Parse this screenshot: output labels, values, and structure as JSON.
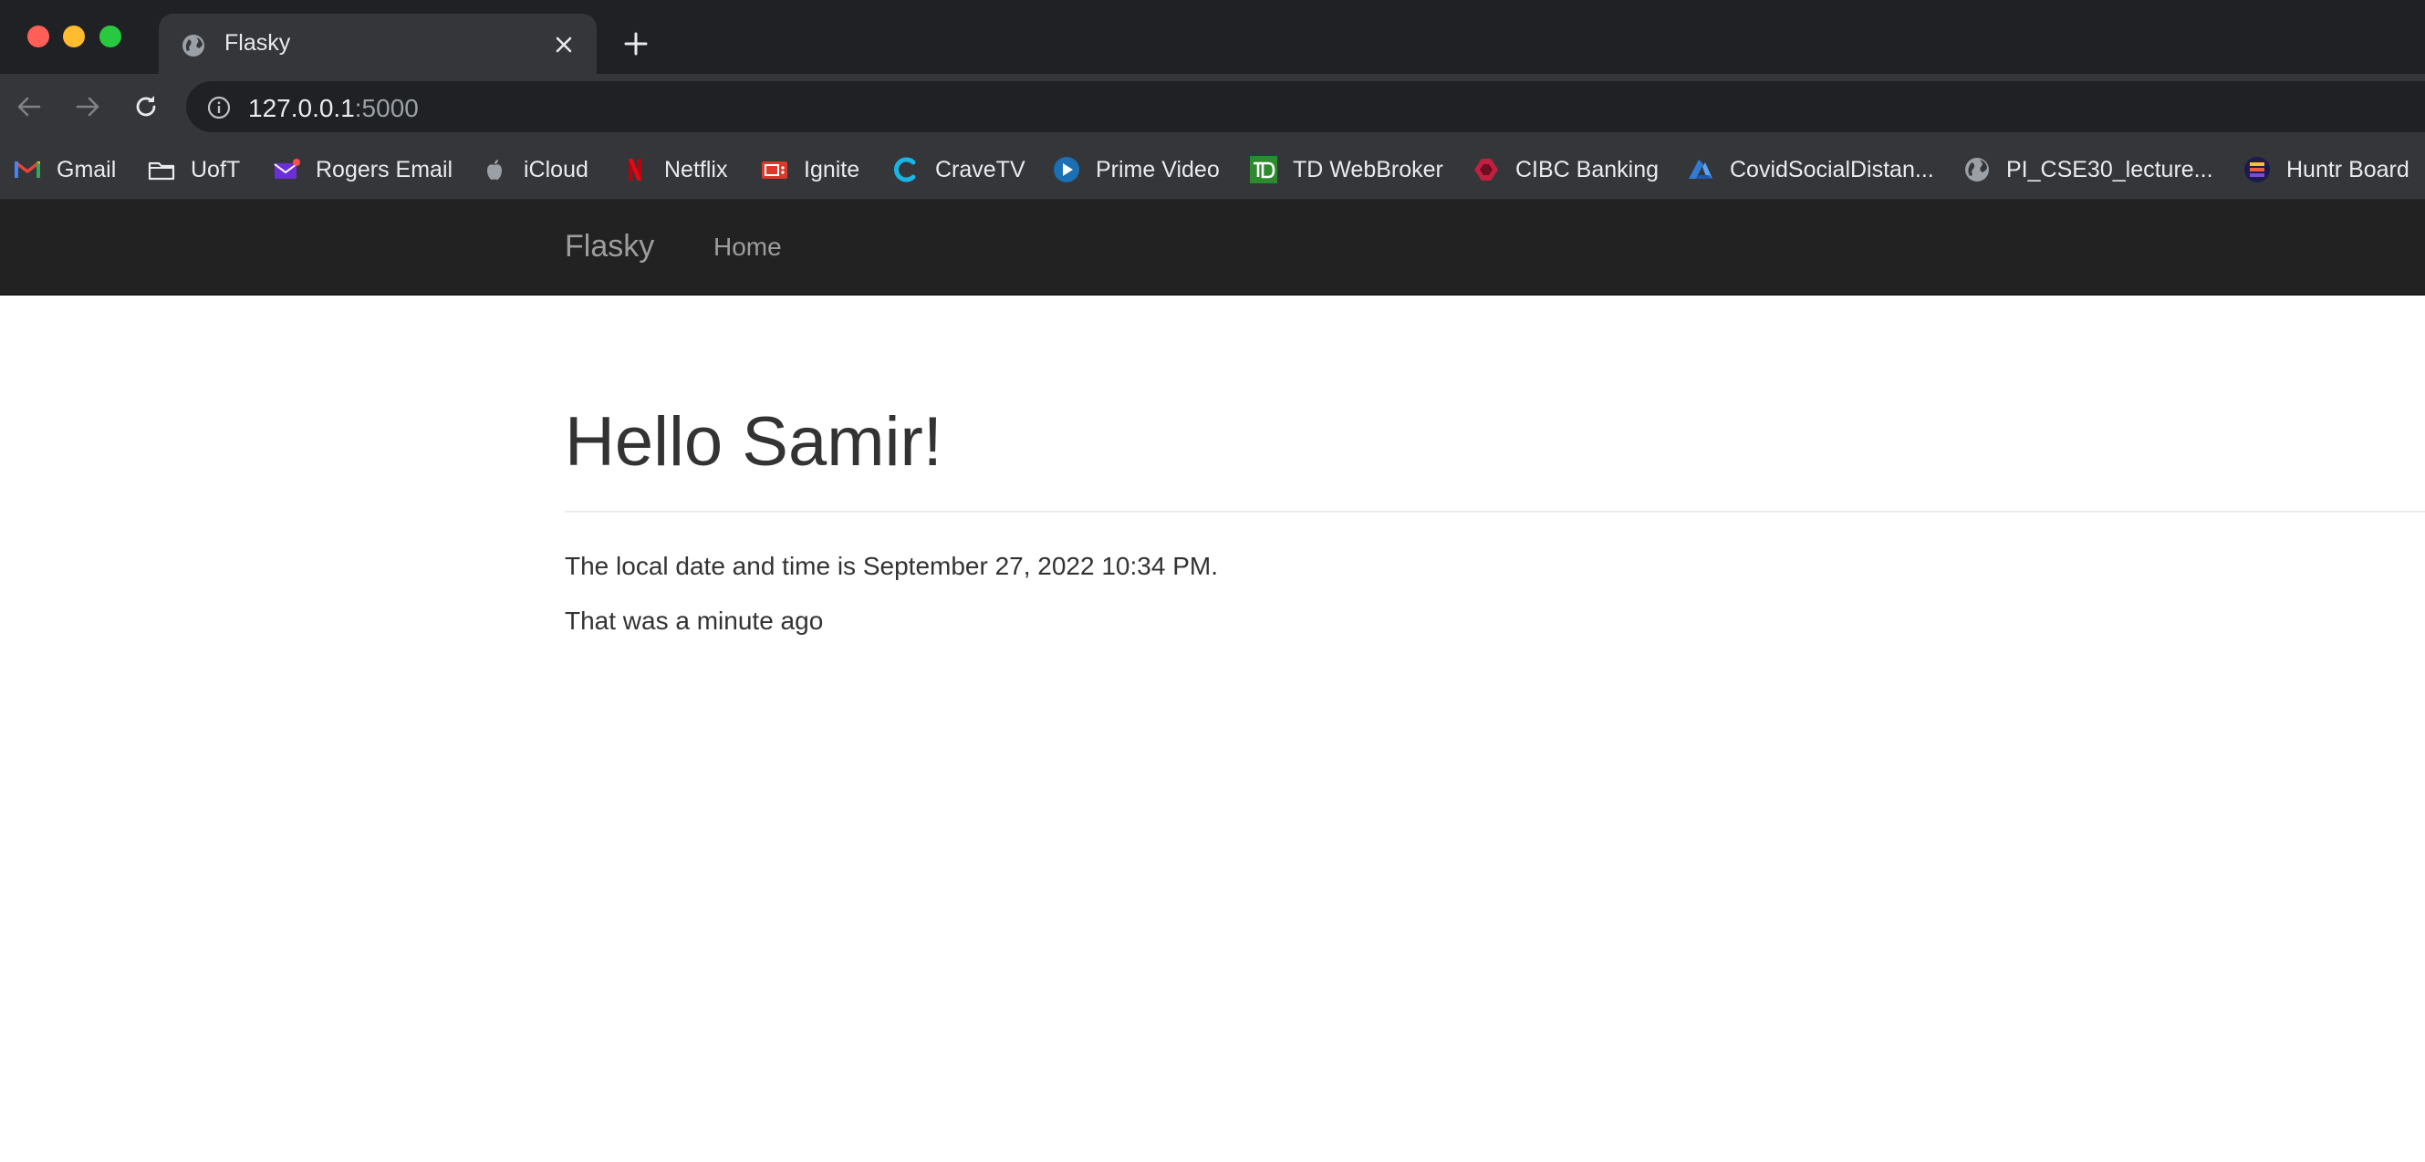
{
  "browser": {
    "tab": {
      "title": "Flasky"
    },
    "url": {
      "host": "127.0.0.1",
      "port": ":5000"
    },
    "bookmarks": [
      {
        "label": "Gmail",
        "icon": "gmail-icon"
      },
      {
        "label": "UofT",
        "icon": "folder-icon"
      },
      {
        "label": "Rogers Email",
        "icon": "envelope-icon"
      },
      {
        "label": "iCloud",
        "icon": "apple-icon"
      },
      {
        "label": "Netflix",
        "icon": "netflix-icon"
      },
      {
        "label": "Ignite",
        "icon": "ignite-icon"
      },
      {
        "label": "CraveTV",
        "icon": "crave-icon"
      },
      {
        "label": "Prime Video",
        "icon": "prime-video-icon"
      },
      {
        "label": "TD WebBroker",
        "icon": "td-icon"
      },
      {
        "label": "CIBC Banking",
        "icon": "cibc-icon"
      },
      {
        "label": "CovidSocialDistan...",
        "icon": "azure-icon"
      },
      {
        "label": "PI_CSE30_lecture...",
        "icon": "globe-icon"
      },
      {
        "label": "Huntr Board",
        "icon": "huntr-icon"
      }
    ]
  },
  "navbar": {
    "brand": "Flasky",
    "home": "Home"
  },
  "main": {
    "heading": "Hello Samir!",
    "datetime_text": "The local date and time is September 27, 2022 10:34 PM.",
    "relative_text": "That was a minute ago"
  },
  "colors": {
    "navbar_bg": "#222222",
    "navbar_text": "#9d9d9d",
    "body_text": "#333333",
    "chrome_dark": "#202124",
    "chrome_toolbar": "#35363a"
  }
}
